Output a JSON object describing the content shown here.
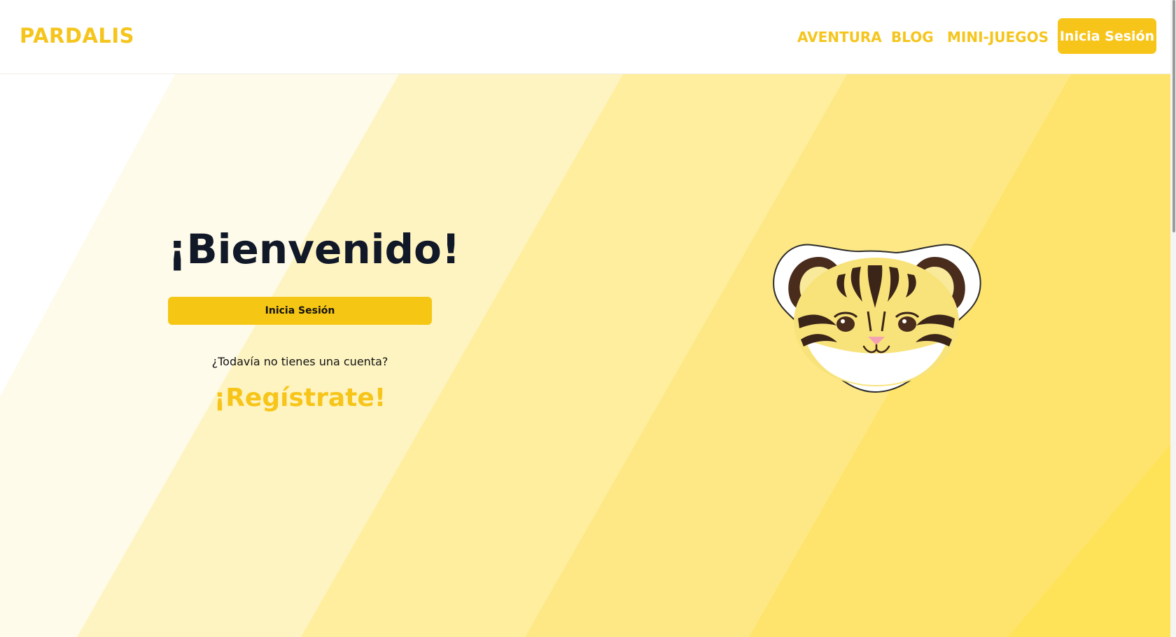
{
  "brand": {
    "name": "PARDALIS",
    "color": "#f5c51d"
  },
  "nav": {
    "items": [
      {
        "label": "AVENTURA"
      },
      {
        "label": "BLOG"
      },
      {
        "label": "MINI-JUEGOS"
      }
    ],
    "login_label": "Inicia Sesión"
  },
  "main": {
    "welcome_title": "¡Bienvenido!",
    "login_label": "Inicia Sesión",
    "no_account_text": "¿Todavía no tienes una cuenta?",
    "register_label": "¡Regístrate!"
  },
  "mascot": {
    "icon": "ocelot-face-icon"
  },
  "colors": {
    "accent": "#f7c51a",
    "heading": "#111827",
    "stripe_light": "#fffbea",
    "stripe_dark": "#ffe14f"
  }
}
